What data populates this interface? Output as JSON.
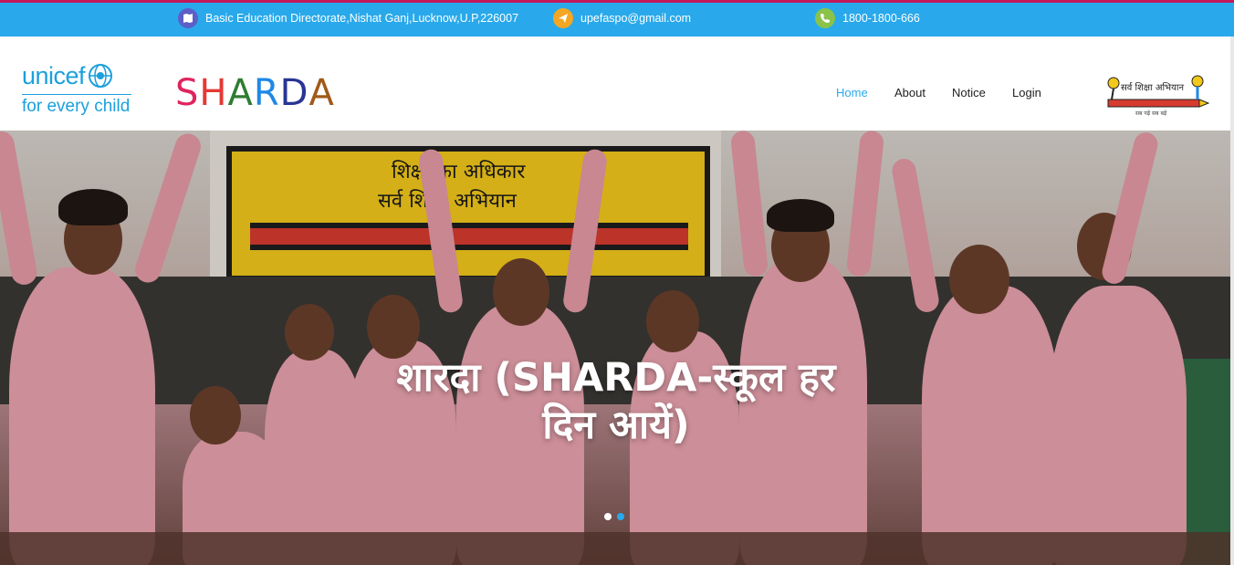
{
  "topbar": {
    "address": "Basic Education Directorate,Nishat Ganj,Lucknow,U.P,226007",
    "email": "upefaspo@gmail.com",
    "phone": "1800-1800-666",
    "icons": [
      "map-icon",
      "send-icon",
      "phone-icon"
    ]
  },
  "unicef": {
    "word": "unicef",
    "tagline": "for every child"
  },
  "brand": {
    "letters": [
      "S",
      "H",
      "A",
      "R",
      "D",
      "A"
    ],
    "colors": [
      "#e0245e",
      "#e53935",
      "#2e7d32",
      "#1e88e5",
      "#283593",
      "#a05a18"
    ]
  },
  "nav": {
    "items": [
      "Home",
      "About",
      "Notice",
      "Login"
    ],
    "active": "Home"
  },
  "ssa_logo": {
    "title": "सर्व शिक्षा अभियान",
    "subtitle": "सब पढ़ें सब बढ़ें"
  },
  "hero": {
    "board_line1": "शिक्षा का अधिकार",
    "board_line2": "सर्व शिक्षा अभियान",
    "caption_line1": "शारदा (SHARDA-स्कूल हर",
    "caption_line2": "दिन आयें)",
    "slides_count": 2,
    "active_slide": 2
  },
  "colors": {
    "topbar": "#29a9eb",
    "accent": "#29a9eb"
  }
}
